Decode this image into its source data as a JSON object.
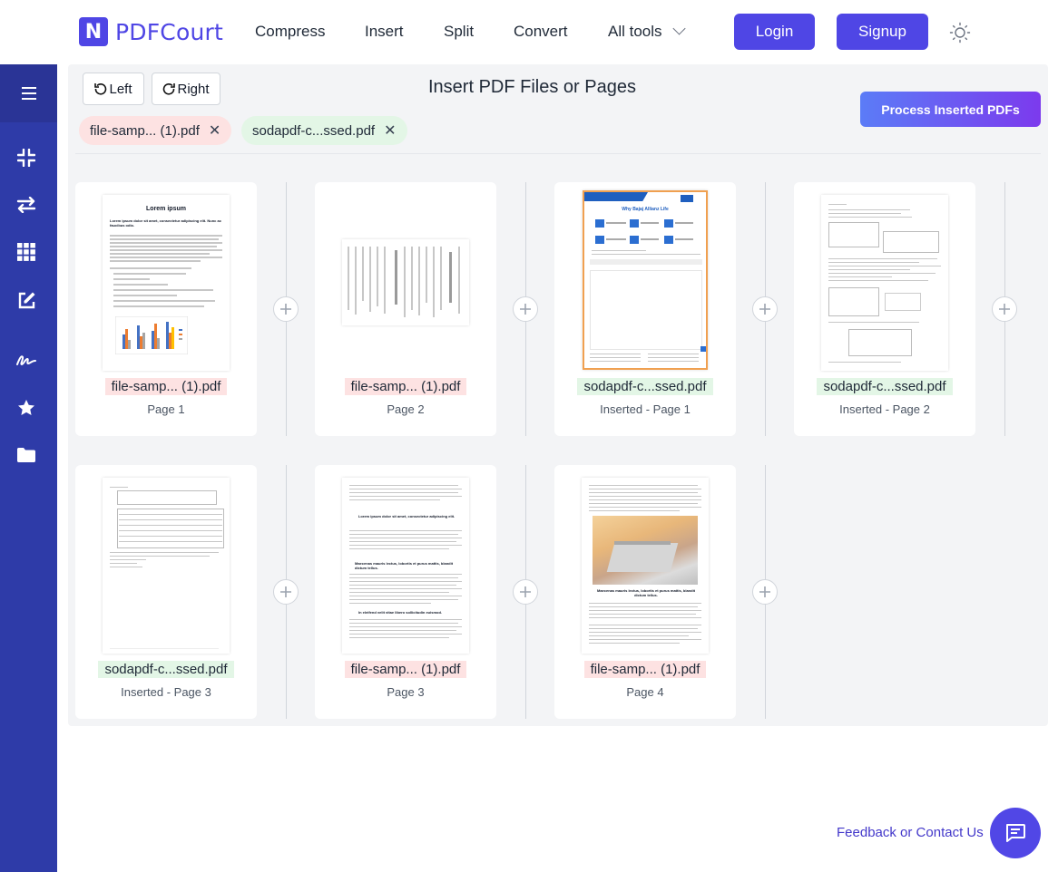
{
  "brand": {
    "logo_letter": "N",
    "name": "PDFCourt"
  },
  "nav": {
    "compress": "Compress",
    "insert": "Insert",
    "split": "Split",
    "convert": "Convert",
    "all_tools": "All tools"
  },
  "auth": {
    "login": "Login",
    "signup": "Signup"
  },
  "sidebar": {
    "icons": [
      "menu-icon",
      "compress-icon",
      "swap-icon",
      "grid-icon",
      "edit-icon",
      "signature-icon",
      "star-icon",
      "folder-icon"
    ]
  },
  "toolbar": {
    "rotate_left": "Left",
    "rotate_right": "Right",
    "title": "Insert PDF Files or Pages",
    "process": "Process Inserted PDFs"
  },
  "chips": [
    {
      "name": "file-samp... (1).pdf",
      "color": "#fde2e2"
    },
    {
      "name": "sodapdf-c...ssed.pdf",
      "color": "#e3f6e6"
    }
  ],
  "pages": [
    {
      "file": "file-samp... (1).pdf",
      "label": "Page 1",
      "source": "original"
    },
    {
      "file": "file-samp... (1).pdf",
      "label": "Page 2",
      "source": "original"
    },
    {
      "file": "sodapdf-c...ssed.pdf",
      "label": "Inserted - Page 1",
      "source": "inserted"
    },
    {
      "file": "sodapdf-c...ssed.pdf",
      "label": "Inserted - Page 2",
      "source": "inserted"
    },
    {
      "file": "sodapdf-c...ssed.pdf",
      "label": "Inserted - Page 3",
      "source": "inserted"
    },
    {
      "file": "file-samp... (1).pdf",
      "label": "Page 3",
      "source": "original"
    },
    {
      "file": "file-samp... (1).pdf",
      "label": "Page 4",
      "source": "original"
    }
  ],
  "thumb_text": {
    "lorem_title": "Lorem ipsum",
    "lorem_sub": "Lorem ipsum dolor sit amet, consectetur adipiscing elit. Nunc ac faucibus odio.",
    "bajaj_title": "Why Bajaj Allianz Life",
    "p3_heading": "Lorem ipsum dolor sit amet, consectetur adipiscing elit.",
    "p3_sub1": "Maecenas mauris lectus, lobortis et purus mattis, blandit dictum tellus.",
    "p3_sub2": "In eleifend velit vitae libero sollicitudin euismod.",
    "p4_sub": "Maecenas mauris lectus, lobortis et purus mattis, blandit dictum tellus."
  },
  "footer": {
    "feedback": "Feedback or Contact Us"
  },
  "colors": {
    "primary": "#4f46e5",
    "sidebar": "#2e3ba8",
    "original_tag": "#fde2e2",
    "inserted_tag": "#e3f6e6"
  }
}
